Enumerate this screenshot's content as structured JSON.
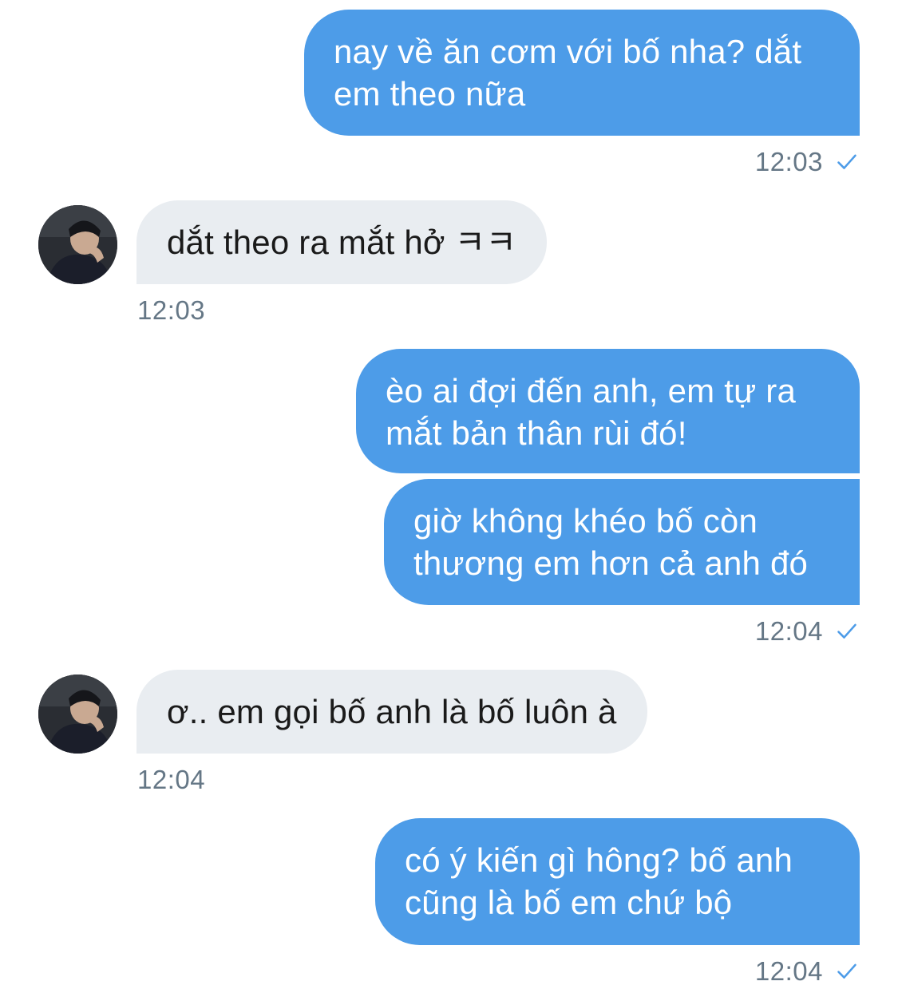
{
  "conversation": {
    "messages": [
      {
        "lines": [
          "nay về ăn cơm với bố nha? dắt",
          "em theo nữa"
        ],
        "time": "12:03"
      },
      {
        "text": "dắt theo ra mắt hở ㅋㅋ",
        "time": "12:03"
      },
      {
        "lines": [
          "èo ai đợi đến anh, em tự ra",
          "mắt bản thân rùi đó!"
        ]
      },
      {
        "lines": [
          "giờ không khéo bố còn",
          "thương em hơn cả anh đó"
        ],
        "time": "12:04"
      },
      {
        "text": "ơ.. em gọi bố anh là bố luôn à",
        "time": "12:04"
      },
      {
        "lines": [
          "có ý kiến gì hông? bố anh",
          "cũng là bố em chứ bộ"
        ],
        "time": "12:04"
      }
    ]
  },
  "colors": {
    "outgoing_bubble": "#4d9ce8",
    "incoming_bubble": "#e9edf1",
    "timestamp": "#657786",
    "read_check": "#4d9ce8"
  },
  "icons": {
    "read_receipt": "checkmark-icon",
    "contact_avatar": "avatar"
  }
}
